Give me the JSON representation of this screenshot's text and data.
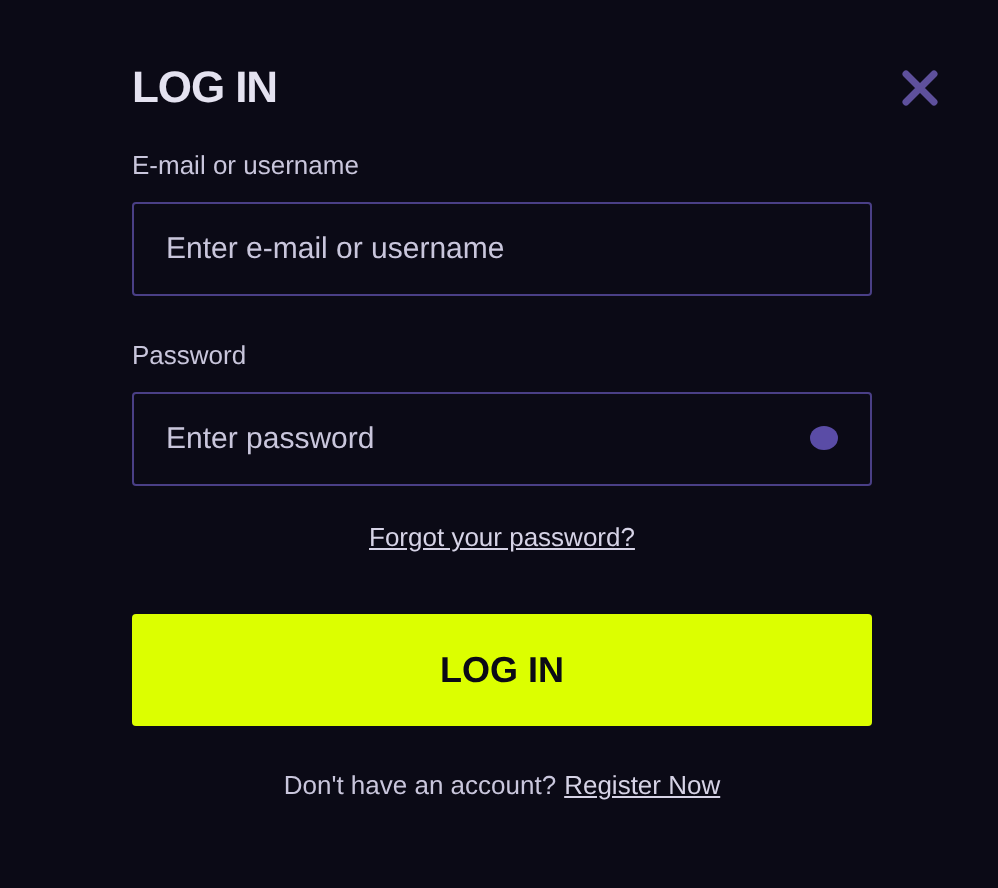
{
  "title": "LOG IN",
  "fields": [
    {
      "label": "E-mail or username",
      "placeholder": "Enter e-mail or username",
      "kind": "text"
    },
    {
      "label": "Password",
      "placeholder": "Enter password",
      "kind": "password"
    }
  ],
  "forgot_link": "Forgot your password?",
  "submit_button": "LOG IN",
  "footer": {
    "text": "Don't have an account?",
    "link": "Register Now"
  }
}
